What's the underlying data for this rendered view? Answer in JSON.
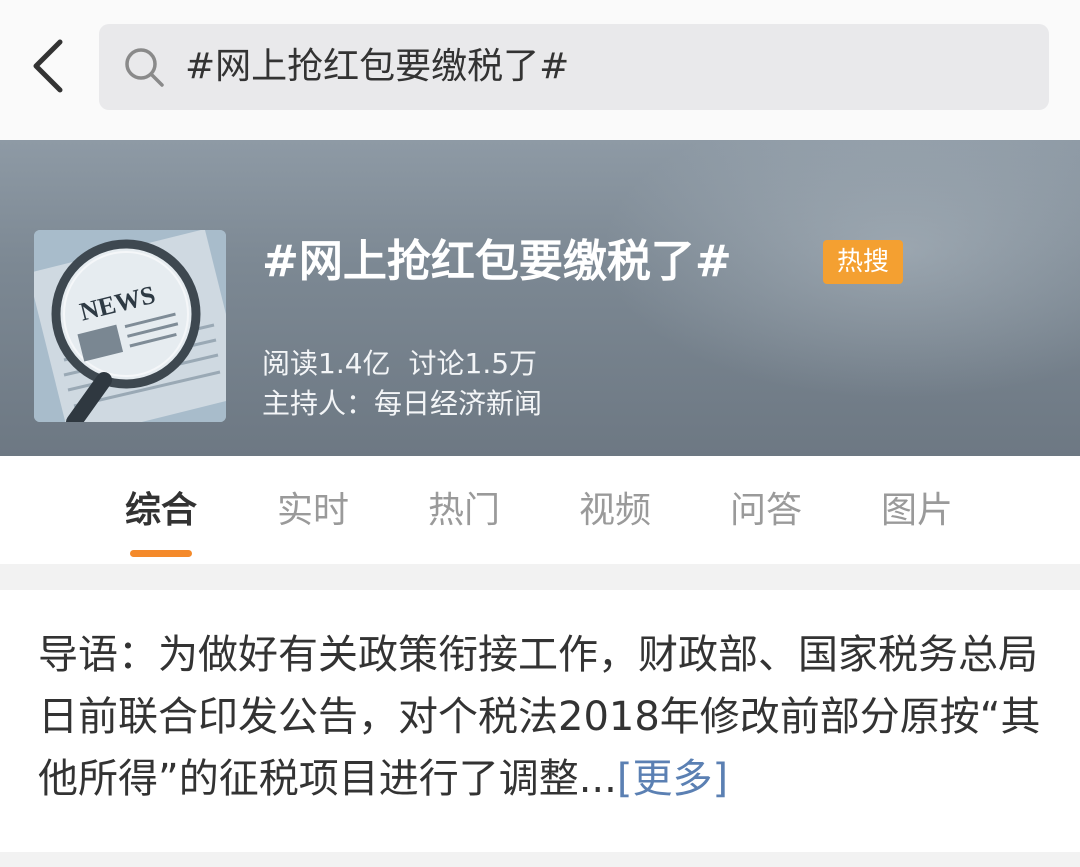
{
  "search": {
    "query": "#网上抢红包要缴税了#"
  },
  "topic": {
    "title": "#网上抢红包要缴税了#",
    "badge": "热搜",
    "reads_label": "阅读1.4亿",
    "discussions_label": "讨论1.5万",
    "host_label": "主持人：",
    "host_name": "每日经济新闻",
    "cover_text": "NEWS"
  },
  "tabs": [
    {
      "label": "综合",
      "active": true
    },
    {
      "label": "实时",
      "active": false
    },
    {
      "label": "热门",
      "active": false
    },
    {
      "label": "视频",
      "active": false
    },
    {
      "label": "问答",
      "active": false
    },
    {
      "label": "图片",
      "active": false
    }
  ],
  "intro": {
    "text": "导语：为做好有关政策衔接工作，财政部、国家税务总局日前联合印发公告，对个税法2018年修改前部分原按“其他所得”的征税项目进行了调整...",
    "more_label": "[更多]"
  },
  "colors": {
    "hot_badge": "#f4a031",
    "tab_indicator": "#f48a2b",
    "more_link": "#5b80b3"
  }
}
